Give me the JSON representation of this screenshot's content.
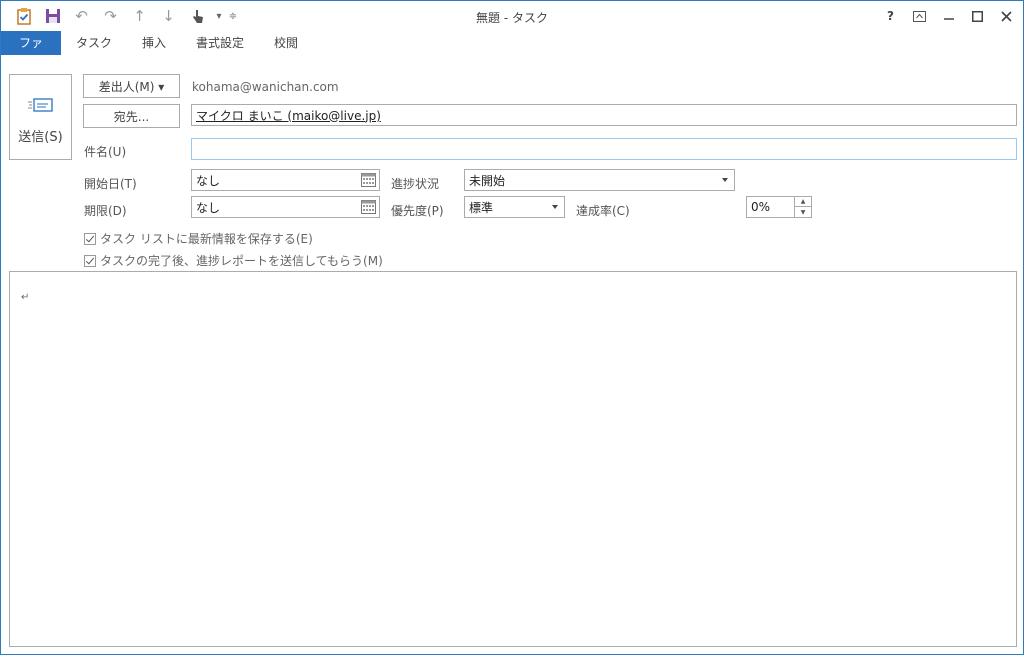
{
  "window": {
    "title": "無題 - タスク"
  },
  "qat": {
    "icons": [
      "task-icon",
      "save-icon",
      "undo-icon",
      "redo-icon",
      "up-arrow-icon",
      "down-arrow-icon",
      "touch-mode-icon",
      "customize-qat-icon"
    ]
  },
  "window_buttons": {
    "help": "?"
  },
  "tabs": [
    "ファイル",
    "タスク",
    "挿入",
    "書式設定",
    "校閲"
  ],
  "form": {
    "send_label": "送信(S)",
    "from_button": "差出人(M) ▾",
    "from_value": "kohama@wanichan.com",
    "to_button": "宛先...",
    "to_value": "マイクロ まいこ (maiko@live.jp)",
    "subject_label": "件名(U)",
    "subject_value": "",
    "start_label": "開始日(T)",
    "start_value": "なし",
    "due_label": "期限(D)",
    "due_value": "なし",
    "status_label": "進捗状況",
    "status_value": "未開始",
    "priority_label": "優先度(P)",
    "priority_value": "標準",
    "complete_label": "達成率(C)",
    "complete_value": "0%",
    "check1": "タスク リストに最新情報を保存する(E)",
    "check2": "タスクの完了後、進捗レポートを送信してもらう(M)"
  },
  "body": {
    "paragraph_mark": "↵"
  }
}
